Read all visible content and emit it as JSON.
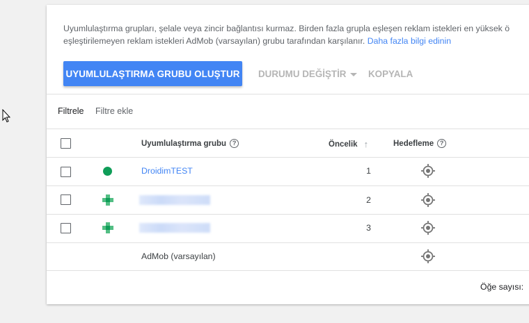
{
  "description": {
    "line1": "Uyumlulaştırma grupları, şelale veya zincir bağlantısı kurmaz. Birden fazla grupla eşleşen reklam istekleri en yüksek ö",
    "line2": "eşleştirilemeyen reklam istekleri AdMob (varsayılan) grubu tarafından karşılanır.",
    "link": "Daha fazla bilgi edinin"
  },
  "toolbar": {
    "create_label": "UYUMLULAŞTIRMA GRUBU OLUŞTUR",
    "status_label": "DURUMU DEĞİŞTİR",
    "copy_label": "KOPYALA"
  },
  "filter": {
    "label": "Filtrele",
    "add_label": "Filtre ekle"
  },
  "table": {
    "columns": {
      "group": "Uyumlulaştırma grubu",
      "priority": "Öncelik",
      "targeting": "Hedefleme"
    },
    "rows": [
      {
        "name": "DroidimTEST",
        "priority": "1",
        "status_color": "#0f9d58"
      },
      {
        "name": "",
        "priority": "2",
        "status_color": "#0f9d58"
      },
      {
        "name": "",
        "priority": "3",
        "status_color": "#0f9d58"
      },
      {
        "name": "AdMob (varsayılan)",
        "priority": ""
      }
    ]
  },
  "footer": {
    "item_count_label": "Öğe sayısı:"
  },
  "icons": {
    "help": "help-circle-icon",
    "sort": "arrow-up-icon",
    "targeting": "crosshair-target-icon",
    "cursor": "mouse-pointer-icon"
  },
  "colors": {
    "primary": "#4285f4",
    "active_status": "#0f9d58",
    "disabled": "#b5b5b5"
  }
}
